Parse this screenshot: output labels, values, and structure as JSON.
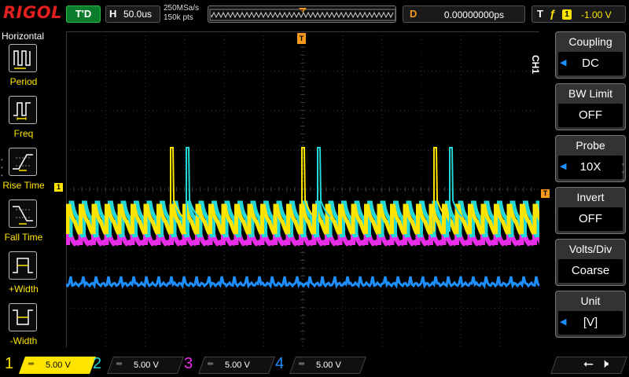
{
  "topbar": {
    "logo": "RIGOL",
    "run_status": "T'D",
    "timebase_label": "H",
    "timebase_value": "50.0us",
    "sample_rate": "250MSa/s",
    "memory_depth": "150k pts",
    "trigger_position_label": "T",
    "delay_label": "D",
    "delay_value": "0.00000000ps",
    "trigger_label": "T",
    "trigger_edge": "ƒ",
    "trigger_source": "1",
    "trigger_level": "-1.00 V"
  },
  "left_menu": {
    "title": "Horizontal",
    "items": [
      {
        "label": "Period",
        "icon": "period-icon"
      },
      {
        "label": "Freq",
        "icon": "freq-icon"
      },
      {
        "label": "Rise Time",
        "icon": "rise-time-icon"
      },
      {
        "label": "Fall Time",
        "icon": "fall-time-icon"
      },
      {
        "label": "+Width",
        "icon": "positive-width-icon"
      },
      {
        "label": "-Width",
        "icon": "negative-width-icon"
      }
    ]
  },
  "right_menu": {
    "channel_tag": "CH1",
    "items": [
      {
        "title": "Coupling",
        "value": "DC",
        "arrow": true
      },
      {
        "title": "BW Limit",
        "value": "OFF",
        "arrow": false
      },
      {
        "title": "Probe",
        "value": "10X",
        "arrow": true
      },
      {
        "title": "Invert",
        "value": "OFF",
        "arrow": false
      },
      {
        "title": "Volts/Div",
        "value": "Coarse",
        "arrow": false
      },
      {
        "title": "Unit",
        "value": "[V]",
        "arrow": true
      }
    ]
  },
  "channels": [
    {
      "num": "1",
      "coupling_icon": "dc-coupling-icon",
      "scale": "5.00 V",
      "color": "#ffe400",
      "active": true
    },
    {
      "num": "2",
      "coupling_icon": "dc-coupling-icon",
      "scale": "5.00 V",
      "color": "#25d8d8",
      "active": false
    },
    {
      "num": "3",
      "coupling_icon": "dc-coupling-icon",
      "scale": "5.00 V",
      "color": "#e82de8",
      "active": false
    },
    {
      "num": "4",
      "coupling_icon": "dc-coupling-icon",
      "scale": "5.00 V",
      "color": "#1e8fff",
      "active": false
    }
  ],
  "markers": {
    "ch1": "1",
    "trigger_level": "T",
    "trigger_position": "T"
  },
  "colors": {
    "ch1": "#ffe400",
    "ch2": "#25d8d8",
    "ch3": "#e82de8",
    "ch4": "#1e8fff",
    "trigger": "#f39a1e",
    "grid": "#3a3a3a"
  }
}
